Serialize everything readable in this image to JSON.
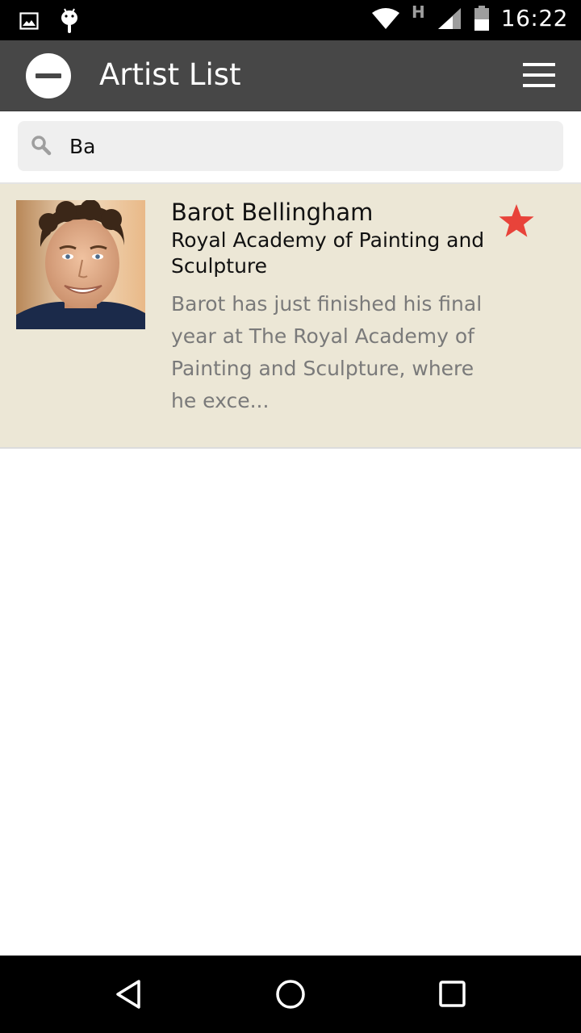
{
  "status_bar": {
    "time": "16:22",
    "network_type": "H",
    "icons": [
      "image-icon",
      "android-icon",
      "wifi-icon",
      "signal-icon",
      "battery-icon"
    ]
  },
  "app_bar": {
    "title": "Artist List",
    "left_icon": "remove-circle-icon",
    "right_icon": "hamburger-menu-icon"
  },
  "search": {
    "value": "Ba",
    "icon": "search-icon"
  },
  "artists": [
    {
      "name": "Barot Bellingham",
      "school": "Royal Academy of Painting and Sculpture",
      "description": "Barot has just finished his final year at The Royal Academy of Painting and Sculpture, where he exce...",
      "favorite": true
    }
  ],
  "colors": {
    "app_bar": "#474747",
    "list_item_bg": "#ece7d6",
    "star": "#e8433a",
    "search_bg": "#efefef"
  },
  "nav_bar": {
    "icons": [
      "back-icon",
      "home-icon",
      "recents-icon"
    ]
  }
}
